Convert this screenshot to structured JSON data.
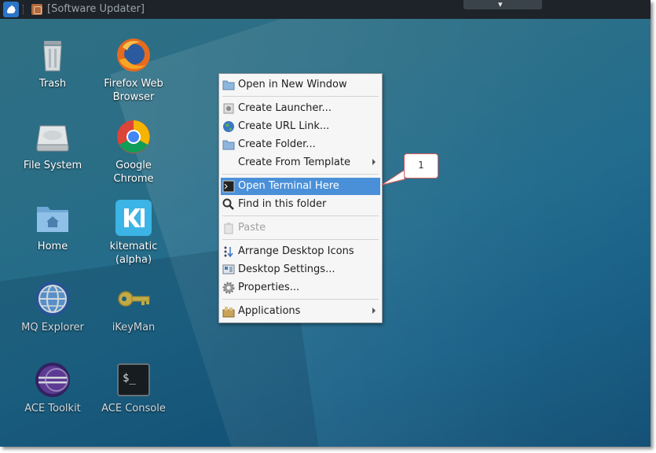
{
  "panel": {
    "window_title": "[Software Updater]"
  },
  "desktop": {
    "icons": [
      {
        "label": "Trash"
      },
      {
        "label": "Firefox Web\nBrowser"
      },
      {
        "label": "File System"
      },
      {
        "label": "Google\nChrome"
      },
      {
        "label": "Home"
      },
      {
        "label": "kitematic\n(alpha)"
      },
      {
        "label": "MQ Explorer"
      },
      {
        "label": "iKeyMan"
      },
      {
        "label": "ACE Toolkit"
      },
      {
        "label": "ACE Console"
      }
    ]
  },
  "context_menu": {
    "items": [
      {
        "label": "Open in New Window",
        "icon": "folder-icon"
      },
      {
        "label": "Create Launcher...",
        "icon": "launcher-icon"
      },
      {
        "label": "Create URL Link...",
        "icon": "globe-icon"
      },
      {
        "label": "Create Folder...",
        "icon": "folder-icon"
      },
      {
        "label": "Create From Template",
        "icon": "",
        "submenu": true
      },
      {
        "label": "Open Terminal Here",
        "icon": "terminal-icon",
        "highlighted": true
      },
      {
        "label": "Find in this folder",
        "icon": "magnifier-icon"
      },
      {
        "label": "Paste",
        "icon": "clipboard-icon",
        "disabled": true
      },
      {
        "label": "Arrange Desktop Icons",
        "icon": "arrange-icon"
      },
      {
        "label": "Desktop Settings...",
        "icon": "desktop-settings-icon"
      },
      {
        "label": "Properties...",
        "icon": "gear-icon"
      },
      {
        "label": "Applications",
        "icon": "applications-icon",
        "submenu": true
      }
    ]
  },
  "annotation": {
    "callout_number": "1"
  },
  "colors": {
    "highlight": "#4a90d9",
    "callout_border": "#d65a5a",
    "panel": "#1d2329"
  }
}
